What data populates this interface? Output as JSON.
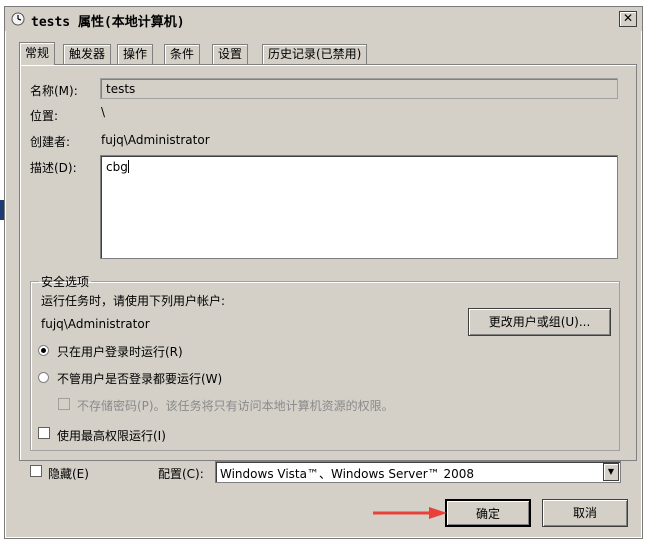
{
  "window": {
    "title": "tests 属性(本地计算机)",
    "close_glyph": "✕"
  },
  "tabs": [
    {
      "label": "常规",
      "active": true
    },
    {
      "label": "触发器"
    },
    {
      "label": "操作"
    },
    {
      "label": "条件"
    },
    {
      "label": "设置"
    },
    {
      "label": "历史记录(已禁用)"
    }
  ],
  "general": {
    "name_label": "名称(M):",
    "name_value": "tests",
    "location_label": "位置:",
    "location_value": "\\",
    "author_label": "创建者:",
    "author_value": "fujq\\Administrator",
    "description_label": "描述(D):",
    "description_value": "cbg"
  },
  "security": {
    "legend": "安全选项",
    "run_as_prompt": "运行任务时，请使用下列用户帐户:",
    "account": "fujq\\Administrator",
    "change_user_button": "更改用户或组(U)...",
    "radio_logged_on": "只在用户登录时运行(R)",
    "radio_whether_logged": "不管用户是否登录都要运行(W)",
    "no_store_password": "不存储密码(P)。该任务将只有访问本地计算机资源的权限。",
    "highest_privileges": "使用最高权限运行(I)"
  },
  "bottom": {
    "hidden_label": "隐藏(E)",
    "configure_label": "配置(C):",
    "configure_value": "Windows Vista™、Windows Server™ 2008",
    "ok_button": "确定",
    "cancel_button": "取消"
  },
  "colors": {
    "dialog_bg": "#d4d0c8",
    "annotation_arrow": "#e8413a"
  }
}
